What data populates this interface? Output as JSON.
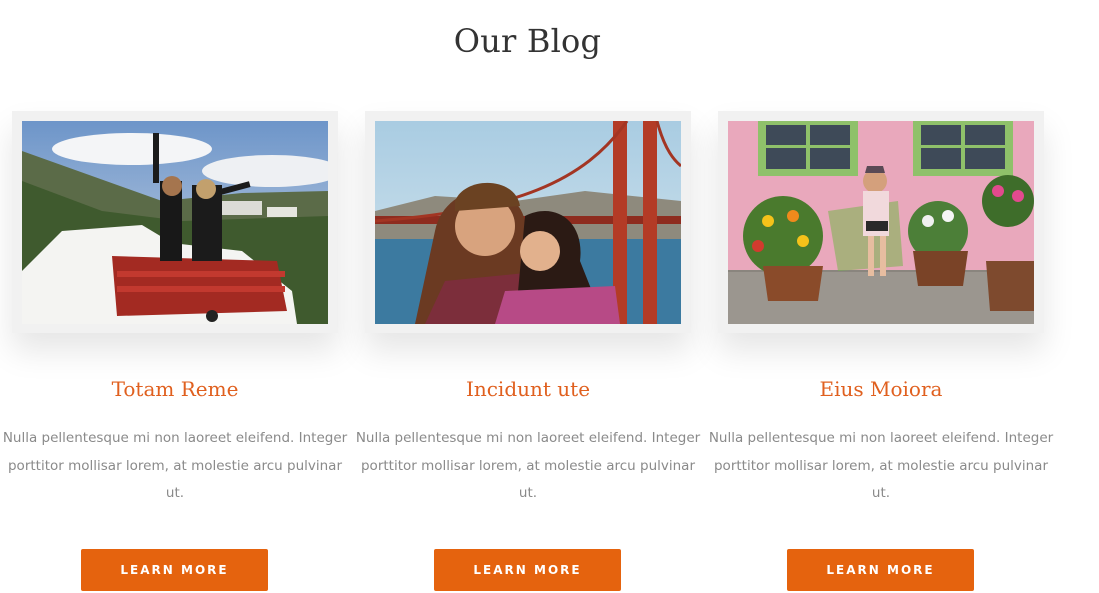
{
  "section": {
    "title": "Our Blog"
  },
  "posts": [
    {
      "title": "Totam Reme",
      "excerpt": "Nulla pellentesque mi non laoreet eleifend. Integer porttitor mollisar lorem, at molestie arcu pulvinar ut.",
      "button_label": "LEARN MORE",
      "image_icon": "photo-convertible-car"
    },
    {
      "title": "Incidunt ute",
      "excerpt": "Nulla pellentesque mi non laoreet eleifend. Integer porttitor mollisar lorem, at molestie arcu pulvinar ut.",
      "button_label": "LEARN MORE",
      "image_icon": "photo-golden-gate-couple"
    },
    {
      "title": "Eius Moiora",
      "excerpt": "Nulla pellentesque mi non laoreet eleifend. Integer porttitor mollisar lorem, at molestie arcu pulvinar ut.",
      "button_label": "LEARN MORE",
      "image_icon": "photo-pink-wall-flowers"
    }
  ],
  "colors": {
    "accent": "#e5630e",
    "title_accent": "#e0601f",
    "body_text": "#8a8a8a",
    "heading": "#333333"
  }
}
